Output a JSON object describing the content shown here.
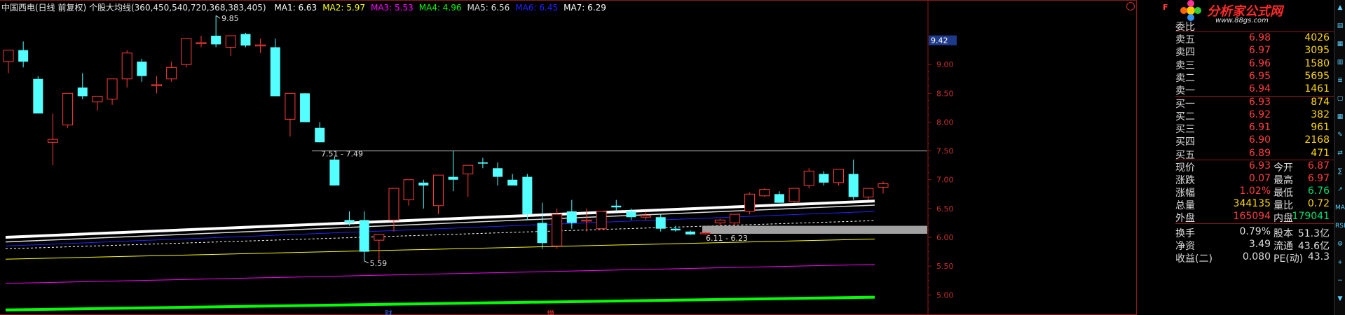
{
  "header": {
    "title": "中国西电(日线 前复权) 个股大均线(360,450,540,720,368,383,405)",
    "ma": [
      {
        "label": "MA1: 6.63",
        "color": "#ffffff"
      },
      {
        "label": "MA2: 5.97",
        "color": "#ffff00"
      },
      {
        "label": "MA3: 5.53",
        "color": "#ff00ff"
      },
      {
        "label": "MA4: 4.96",
        "color": "#00ff00"
      },
      {
        "label": "MA5: 6.56",
        "color": "#dddddd"
      },
      {
        "label": "MA6: 6.45",
        "color": "#2222ff"
      },
      {
        "label": "MA7: 6.29",
        "color": "#ffffff"
      }
    ]
  },
  "logo": {
    "title": "分析家公式网",
    "url": "www.88gs.com",
    "badge": "F"
  },
  "price_axis": {
    "ticks": [
      "9.00",
      "8.50",
      "8.00",
      "7.50",
      "7.00",
      "6.50",
      "6.00",
      "5.50",
      "5.00"
    ],
    "current_label": "9.42"
  },
  "annotations": {
    "high": "9.85",
    "low": "5.59",
    "range_upper": "7.51 - 7.49",
    "range_lower": "6.11 - 6.23",
    "markers": [
      "财",
      "增"
    ]
  },
  "chart_data": {
    "type": "candlestick",
    "ylim": [
      4.7,
      9.95
    ],
    "candles": [
      {
        "o": 9.05,
        "h": 9.25,
        "l": 8.85,
        "c": 9.25
      },
      {
        "o": 9.25,
        "h": 9.4,
        "l": 8.95,
        "c": 9.05
      },
      {
        "o": 8.75,
        "h": 8.8,
        "l": 8.15,
        "c": 8.15
      },
      {
        "o": 7.65,
        "h": 8.15,
        "l": 7.25,
        "c": 7.7
      },
      {
        "o": 7.95,
        "h": 8.5,
        "l": 7.9,
        "c": 8.5
      },
      {
        "o": 8.6,
        "h": 8.85,
        "l": 8.4,
        "c": 8.45
      },
      {
        "o": 8.35,
        "h": 8.45,
        "l": 8.2,
        "c": 8.45
      },
      {
        "o": 8.4,
        "h": 8.75,
        "l": 8.3,
        "c": 8.75
      },
      {
        "o": 8.75,
        "h": 9.25,
        "l": 8.6,
        "c": 9.2
      },
      {
        "o": 9.05,
        "h": 9.1,
        "l": 8.7,
        "c": 8.8
      },
      {
        "o": 8.63,
        "h": 8.8,
        "l": 8.5,
        "c": 8.65
      },
      {
        "o": 8.75,
        "h": 9.05,
        "l": 8.7,
        "c": 8.95
      },
      {
        "o": 9.0,
        "h": 9.45,
        "l": 8.95,
        "c": 9.45
      },
      {
        "o": 9.36,
        "h": 9.5,
        "l": 9.3,
        "c": 9.38
      },
      {
        "o": 9.5,
        "h": 9.85,
        "l": 9.3,
        "c": 9.35
      },
      {
        "o": 9.3,
        "h": 9.5,
        "l": 9.15,
        "c": 9.5
      },
      {
        "o": 9.53,
        "h": 9.55,
        "l": 9.3,
        "c": 9.33
      },
      {
        "o": 9.34,
        "h": 9.45,
        "l": 9.2,
        "c": 9.34
      },
      {
        "o": 9.3,
        "h": 9.45,
        "l": 8.45,
        "c": 8.45
      },
      {
        "o": 8.05,
        "h": 8.5,
        "l": 7.75,
        "c": 8.5
      },
      {
        "o": 8.5,
        "h": 8.5,
        "l": 8.0,
        "c": 8.0
      },
      {
        "o": 7.9,
        "h": 8.0,
        "l": 7.65,
        "c": 7.65
      },
      {
        "o": 7.35,
        "h": 7.4,
        "l": 6.9,
        "c": 6.9
      },
      {
        "o": 6.3,
        "h": 6.45,
        "l": 6.2,
        "c": 6.25
      },
      {
        "o": 6.3,
        "h": 6.45,
        "l": 5.59,
        "c": 5.75
      },
      {
        "o": 5.95,
        "h": 6.05,
        "l": 5.59,
        "c": 6.05
      },
      {
        "o": 6.3,
        "h": 6.85,
        "l": 6.1,
        "c": 6.85
      },
      {
        "o": 6.65,
        "h": 7.0,
        "l": 6.55,
        "c": 7.0
      },
      {
        "o": 6.95,
        "h": 7.0,
        "l": 6.5,
        "c": 6.9
      },
      {
        "o": 6.55,
        "h": 7.08,
        "l": 6.4,
        "c": 7.08
      },
      {
        "o": 7.05,
        "h": 7.5,
        "l": 6.8,
        "c": 7.0
      },
      {
        "o": 7.1,
        "h": 7.25,
        "l": 6.7,
        "c": 7.25
      },
      {
        "o": 7.3,
        "h": 7.38,
        "l": 7.2,
        "c": 7.28
      },
      {
        "o": 7.2,
        "h": 7.3,
        "l": 6.9,
        "c": 7.05
      },
      {
        "o": 7.0,
        "h": 7.1,
        "l": 6.9,
        "c": 6.9
      },
      {
        "o": 7.05,
        "h": 7.1,
        "l": 6.3,
        "c": 6.4
      },
      {
        "o": 6.25,
        "h": 6.6,
        "l": 5.8,
        "c": 5.9
      },
      {
        "o": 5.85,
        "h": 6.5,
        "l": 5.8,
        "c": 6.4
      },
      {
        "o": 6.45,
        "h": 6.65,
        "l": 6.15,
        "c": 6.25
      },
      {
        "o": 6.3,
        "h": 6.5,
        "l": 6.1,
        "c": 6.3
      },
      {
        "o": 6.15,
        "h": 6.45,
        "l": 6.15,
        "c": 6.45
      },
      {
        "o": 6.55,
        "h": 6.65,
        "l": 6.45,
        "c": 6.52
      },
      {
        "o": 6.45,
        "h": 6.5,
        "l": 6.3,
        "c": 6.35
      },
      {
        "o": 6.35,
        "h": 6.45,
        "l": 6.3,
        "c": 6.38
      },
      {
        "o": 6.35,
        "h": 6.4,
        "l": 6.1,
        "c": 6.15
      },
      {
        "o": 6.15,
        "h": 6.2,
        "l": 6.1,
        "c": 6.12
      },
      {
        "o": 6.1,
        "h": 6.12,
        "l": 6.04,
        "c": 6.05
      },
      {
        "o": 6.07,
        "h": 6.1,
        "l": 6.05,
        "c": 6.08
      },
      {
        "o": 6.25,
        "h": 6.32,
        "l": 6.2,
        "c": 6.3
      },
      {
        "o": 6.25,
        "h": 6.4,
        "l": 6.2,
        "c": 6.4
      },
      {
        "o": 6.45,
        "h": 6.78,
        "l": 6.4,
        "c": 6.75
      },
      {
        "o": 6.72,
        "h": 6.85,
        "l": 6.7,
        "c": 6.83
      },
      {
        "o": 6.75,
        "h": 6.8,
        "l": 6.6,
        "c": 6.6
      },
      {
        "o": 6.62,
        "h": 6.85,
        "l": 6.6,
        "c": 6.85
      },
      {
        "o": 6.9,
        "h": 7.2,
        "l": 6.85,
        "c": 7.15
      },
      {
        "o": 7.1,
        "h": 7.15,
        "l": 6.9,
        "c": 6.95
      },
      {
        "o": 6.95,
        "h": 7.18,
        "l": 6.9,
        "c": 7.18
      },
      {
        "o": 7.1,
        "h": 7.35,
        "l": 6.65,
        "c": 6.7
      },
      {
        "o": 6.7,
        "h": 6.85,
        "l": 6.65,
        "c": 6.85
      },
      {
        "o": 6.87,
        "h": 6.97,
        "l": 6.76,
        "c": 6.93
      }
    ],
    "ma_lines": [
      {
        "color": "#ffffff",
        "width": 4,
        "dash": false,
        "from": 6.0,
        "to": 6.63
      },
      {
        "color": "#ffff00",
        "width": 1,
        "dash": false,
        "from": 5.62,
        "to": 5.97
      },
      {
        "color": "#ff00ff",
        "width": 1,
        "dash": false,
        "from": 5.2,
        "to": 5.53
      },
      {
        "color": "#00ff00",
        "width": 4,
        "dash": false,
        "from": 4.74,
        "to": 4.96
      },
      {
        "color": "#dddddd",
        "width": 1.5,
        "dash": false,
        "from": 5.92,
        "to": 6.56
      },
      {
        "color": "#2222ff",
        "width": 1,
        "dash": false,
        "from": 5.85,
        "to": 6.45
      },
      {
        "color": "#ffffff",
        "width": 1,
        "dash": true,
        "from": 5.8,
        "to": 6.29
      }
    ]
  },
  "quote": {
    "committee": {
      "label": "委比"
    },
    "asks": [
      {
        "label": "卖五",
        "price": "6.98",
        "vol": "4026"
      },
      {
        "label": "卖四",
        "price": "6.97",
        "vol": "3095"
      },
      {
        "label": "卖三",
        "price": "6.96",
        "vol": "1580"
      },
      {
        "label": "卖二",
        "price": "6.95",
        "vol": "5695"
      },
      {
        "label": "卖一",
        "price": "6.94",
        "vol": "1461"
      }
    ],
    "bids": [
      {
        "label": "买一",
        "price": "6.93",
        "vol": "874"
      },
      {
        "label": "买二",
        "price": "6.92",
        "vol": "382"
      },
      {
        "label": "买三",
        "price": "6.91",
        "vol": "961"
      },
      {
        "label": "买四",
        "price": "6.90",
        "vol": "2168"
      },
      {
        "label": "买五",
        "price": "6.89",
        "vol": "471"
      }
    ],
    "stats1": [
      {
        "l1": "现价",
        "v1": "6.93",
        "l2": "今开",
        "v2": "6.87",
        "c1": "#ff3d3d",
        "c2": "#ff3d3d"
      },
      {
        "l1": "涨跌",
        "v1": "0.07",
        "l2": "最高",
        "v2": "6.97",
        "c1": "#ff3d3d",
        "c2": "#ff3d3d"
      },
      {
        "l1": "涨幅",
        "v1": "1.02%",
        "l2": "最低",
        "v2": "6.76",
        "c1": "#ff3d3d",
        "c2": "#00e070"
      },
      {
        "l1": "总量",
        "v1": "344135",
        "l2": "量比",
        "v2": "0.72",
        "c1": "#ffd700",
        "c2": "#ffd700"
      },
      {
        "l1": "外盘",
        "v1": "165094",
        "l2": "内盘",
        "v2": "179041",
        "c1": "#ff3d3d",
        "c2": "#00e070"
      }
    ],
    "stats2": [
      {
        "l1": "换手",
        "v1": "0.79%",
        "l2": "股本",
        "v2": "51.3亿"
      },
      {
        "l1": "净资",
        "v1": "3.49",
        "l2": "流通",
        "v2": "43.6亿"
      },
      {
        "l1": "收益(二)",
        "v1": "0.080",
        "l2": "PE(动)",
        "v2": "43.3"
      }
    ]
  },
  "toolbar": {
    "icons": [
      "up-arrow-icon",
      "chart-icon",
      "grid-icon",
      "bars-icon",
      "list-icon",
      "doc-icon",
      "table-icon",
      "tools-icon",
      "compare-icon",
      "stats-icon",
      "trend-icon",
      "ma-icon",
      "rsi-icon",
      "gear-icon",
      "zoom-in-icon",
      "zoom-out-icon",
      "down-arrow-icon"
    ],
    "labels": [
      "▲",
      "▤",
      "▦",
      "▥",
      "≣",
      "▢",
      "▦",
      "✎",
      "⇄",
      "∑",
      "↗",
      "MA",
      "RSI",
      "⚙",
      "+",
      "−",
      "▼"
    ]
  }
}
